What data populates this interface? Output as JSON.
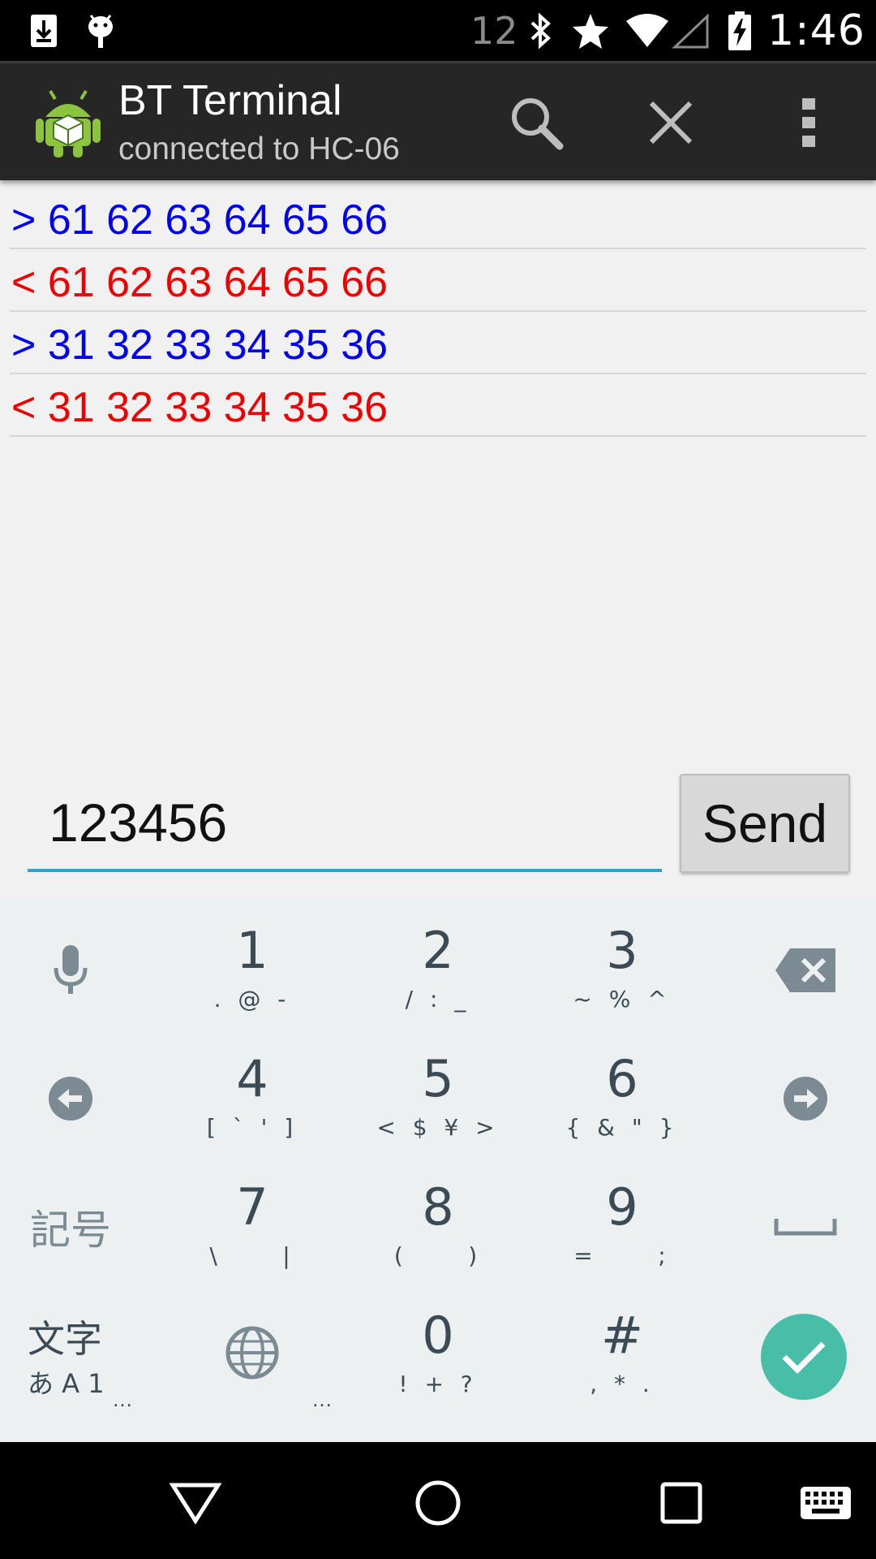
{
  "status_bar": {
    "notification_count": "12",
    "time": "1:46",
    "icons": [
      "download-icon",
      "android-debug-icon",
      "bluetooth-icon",
      "star-icon",
      "wifi-icon",
      "no-signal-icon",
      "battery-charging-icon"
    ]
  },
  "app_bar": {
    "title": "BT Terminal",
    "subtitle": "connected to HC-06",
    "actions": [
      "search-icon",
      "close-icon",
      "overflow-menu-icon"
    ]
  },
  "terminal": {
    "lines": [
      {
        "direction": ">",
        "text": "61 62 63 64 65 66",
        "color": "#0000ee"
      },
      {
        "direction": "<",
        "text": "61 62 63 64 65 66",
        "color": "#ee0000"
      },
      {
        "direction": ">",
        "text": "31 32 33 34 35 36",
        "color": "#0000ee"
      },
      {
        "direction": "<",
        "text": "31 32 33 34 35 36",
        "color": "#ee0000"
      }
    ]
  },
  "input": {
    "value": "123456",
    "send_label": "Send",
    "accent_color": "#29a5cf"
  },
  "keyboard": {
    "keys": [
      {
        "main": "1",
        "sub": ". @ -"
      },
      {
        "main": "2",
        "sub": "/ : _"
      },
      {
        "main": "3",
        "sub": "~ % ^"
      },
      {
        "main": "4",
        "sub": "[ ` ' ]"
      },
      {
        "main": "5",
        "sub": "< $ ¥ >"
      },
      {
        "main": "6",
        "sub": "{ & \" }"
      },
      {
        "main": "7",
        "sub": "\\     |"
      },
      {
        "main": "8",
        "sub": "(     )"
      },
      {
        "main": "9",
        "sub": "=     ;"
      },
      {
        "main": "0",
        "sub": "! + ?"
      },
      {
        "main": "#",
        "sub": ", * ."
      }
    ],
    "kigou_label": "記号",
    "moji_label": "文字",
    "moji_sub": "あ A 1",
    "dots": "…",
    "ok_color": "#48bea8"
  },
  "nav_bar": {
    "buttons": [
      "back-icon",
      "home-icon",
      "recents-icon",
      "keyboard-icon"
    ]
  }
}
